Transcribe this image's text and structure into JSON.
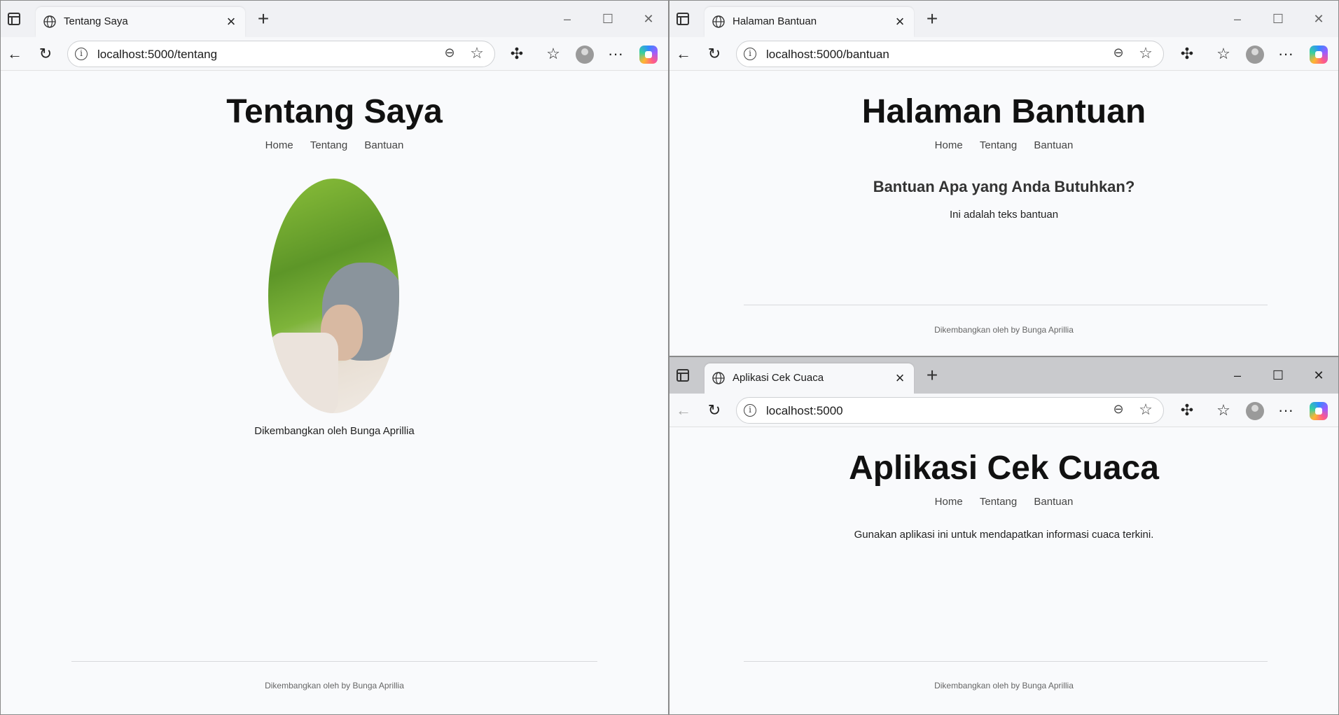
{
  "left": {
    "tab_title": "Tentang Saya",
    "url": "localhost:5000/tentang",
    "heading": "Tentang Saya",
    "nav": [
      "Home",
      "Tentang",
      "Bantuan"
    ],
    "caption": "Dikembangkan oleh Bunga Aprillia",
    "footer": "Dikembangkan oleh by Bunga Aprillia"
  },
  "top_right": {
    "tab_title": "Halaman Bantuan",
    "url": "localhost:5000/bantuan",
    "heading": "Halaman Bantuan",
    "nav": [
      "Home",
      "Tentang",
      "Bantuan"
    ],
    "subheading": "Bantuan Apa yang Anda Butuhkan?",
    "body": "Ini adalah teks bantuan",
    "footer": "Dikembangkan oleh by Bunga Aprillia"
  },
  "bottom_right": {
    "tab_title": "Aplikasi Cek Cuaca",
    "url": "localhost:5000",
    "heading": "Aplikasi Cek Cuaca",
    "nav": [
      "Home",
      "Tentang",
      "Bantuan"
    ],
    "body": "Gunakan aplikasi ini untuk mendapatkan informasi cuaca terkini.",
    "footer": "Dikembangkan oleh by Bunga Aprillia"
  },
  "icons": {
    "globe": "globe-icon",
    "close": "close-icon",
    "new_tab": "plus-icon",
    "back": "back-arrow-icon",
    "refresh": "refresh-icon",
    "info": "info-icon",
    "zoom": "zoom-out-icon",
    "favorite": "star-icon",
    "extensions": "puzzle-icon",
    "favorites": "favorites-icon",
    "profile": "profile-icon",
    "more": "more-icon",
    "copilot": "copilot-icon"
  },
  "colors": {
    "page_bg": "#f9fafc",
    "heading": "#111111",
    "footer_text": "#666666"
  }
}
